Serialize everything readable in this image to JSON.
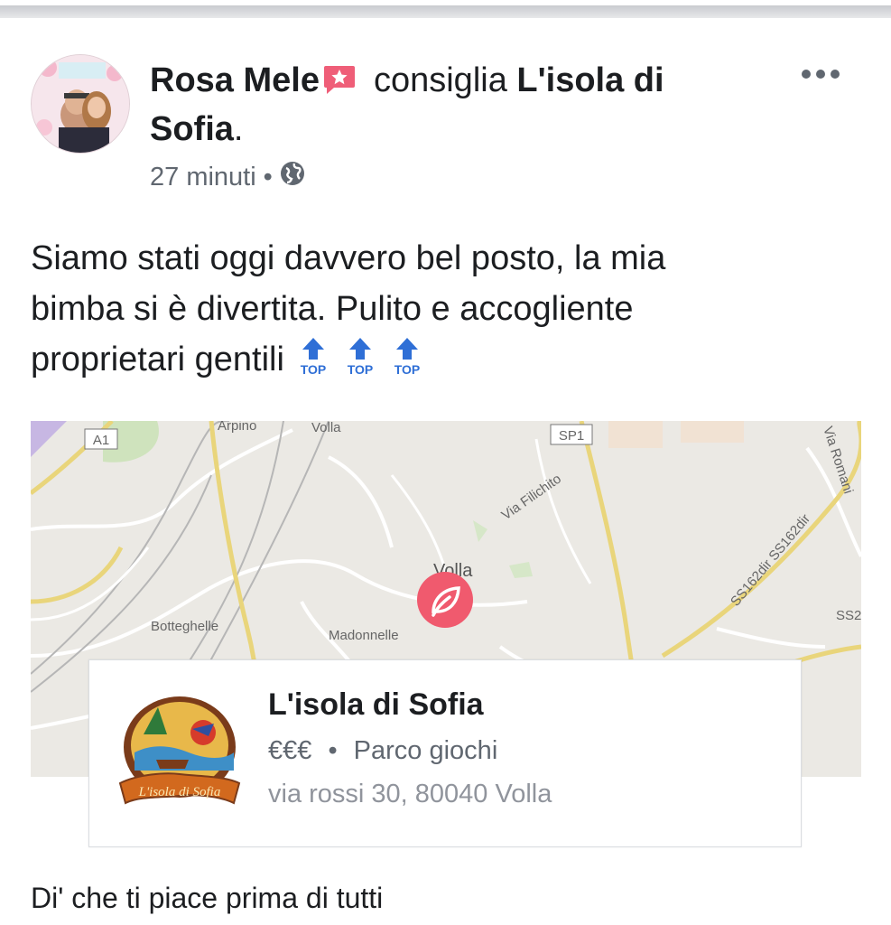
{
  "post": {
    "author": "Rosa Mele",
    "verb": "consiglia",
    "page_name_line1": "L'isola di",
    "page_name_line2": "Sofia",
    "page_name_period": ".",
    "time": "27 minuti",
    "separator": "•",
    "privacy_icon": "globe-icon",
    "text_line1": "Siamo stati oggi davvero bel posto, la mia",
    "text_line2": "bimba si è divertita. Pulito e accogliente",
    "text_line3": "proprietari gentili",
    "emoji_label": "TOP"
  },
  "map": {
    "labels": {
      "a1": "A1",
      "arpino": "Arpino",
      "volla_top": "Volla",
      "sp1": "SP1",
      "via_filichito": "Via Filichito",
      "via_romani": "Via Romani",
      "volla_center": "Volla",
      "ss162": "SS162dir SS162dir",
      "ss2": "SS2",
      "botteghelle": "Botteghelle",
      "madonnelle": "Madonnelle"
    }
  },
  "place_card": {
    "title": "L'isola di Sofia",
    "price": "€€€",
    "dot": "•",
    "category": "Parco giochi",
    "address": "via rossi 30, 80040 Volla",
    "logo_text": "L'isola di Sofia"
  },
  "footer": {
    "like_prompt": "Di' che ti piace prima di tutti"
  },
  "colors": {
    "pin": "#f05a6e",
    "text": "#1c1e21",
    "meta": "#606770",
    "top_emoji": "#2f6fd6"
  }
}
